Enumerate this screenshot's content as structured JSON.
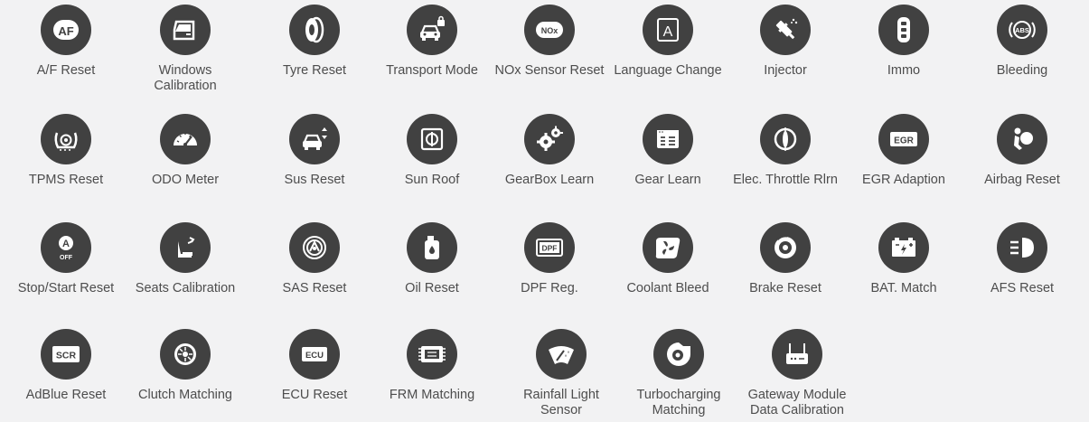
{
  "functions": [
    {
      "label": "A/F Reset",
      "icon": "af-icon",
      "text": "AF"
    },
    {
      "label": "Windows Calibration",
      "icon": "window-icon"
    },
    {
      "label": "Tyre Reset",
      "icon": "tyre-icon"
    },
    {
      "label": "Transport Mode",
      "icon": "car-lock-icon"
    },
    {
      "label": "NOx Sensor Reset",
      "icon": "nox-icon",
      "text": "NOx"
    },
    {
      "label": "Language Change",
      "icon": "language-icon",
      "text": "A"
    },
    {
      "label": "Injector",
      "icon": "injector-icon"
    },
    {
      "label": "Immo",
      "icon": "key-fob-icon"
    },
    {
      "label": "Bleeding",
      "icon": "abs-icon",
      "text": "ABS"
    },
    {
      "label": "TPMS Reset",
      "icon": "tpms-icon"
    },
    {
      "label": "ODO Meter",
      "icon": "odometer-icon"
    },
    {
      "label": "Sus Reset",
      "icon": "suspension-icon"
    },
    {
      "label": "Sun Roof",
      "icon": "sunroof-icon"
    },
    {
      "label": "GearBox Learn",
      "icon": "gears-icon"
    },
    {
      "label": "Gear Learn",
      "icon": "gear-learn-icon"
    },
    {
      "label": "Elec. Throttle Rlrn",
      "icon": "throttle-icon"
    },
    {
      "label": "EGR Adaption",
      "icon": "egr-icon",
      "text": "EGR"
    },
    {
      "label": "Airbag Reset",
      "icon": "airbag-icon"
    },
    {
      "label": "Stop/Start Reset",
      "icon": "stop-start-icon",
      "text": "A",
      "subtext": "OFF"
    },
    {
      "label": "Seats Calibration",
      "icon": "seat-icon"
    },
    {
      "label": "SAS Reset",
      "icon": "steering-angle-icon"
    },
    {
      "label": "Oil Reset",
      "icon": "oil-icon"
    },
    {
      "label": "DPF Reg.",
      "icon": "dpf-icon",
      "text": "DPF"
    },
    {
      "label": "Coolant Bleed",
      "icon": "coolant-icon"
    },
    {
      "label": "Brake Reset",
      "icon": "brake-icon"
    },
    {
      "label": "BAT. Match",
      "icon": "battery-icon"
    },
    {
      "label": "AFS Reset",
      "icon": "headlight-icon"
    },
    {
      "label": "AdBlue Reset",
      "icon": "scr-icon",
      "text": "SCR"
    },
    {
      "label": "Clutch Matching",
      "icon": "clutch-icon"
    },
    {
      "label": "ECU Reset",
      "icon": "ecu-icon",
      "text": "ECU"
    },
    {
      "label": "FRM Matching",
      "icon": "frm-icon"
    },
    {
      "label": "Rainfall Light Sensor",
      "icon": "rain-sensor-icon"
    },
    {
      "label": "Turbocharging Matching",
      "icon": "turbo-icon"
    },
    {
      "label": "Gateway Module Data Calibration",
      "icon": "gateway-icon"
    }
  ],
  "colors": {
    "background": "#f2f2f3",
    "icon_circle": "#414141",
    "label": "#4d4d4d"
  }
}
